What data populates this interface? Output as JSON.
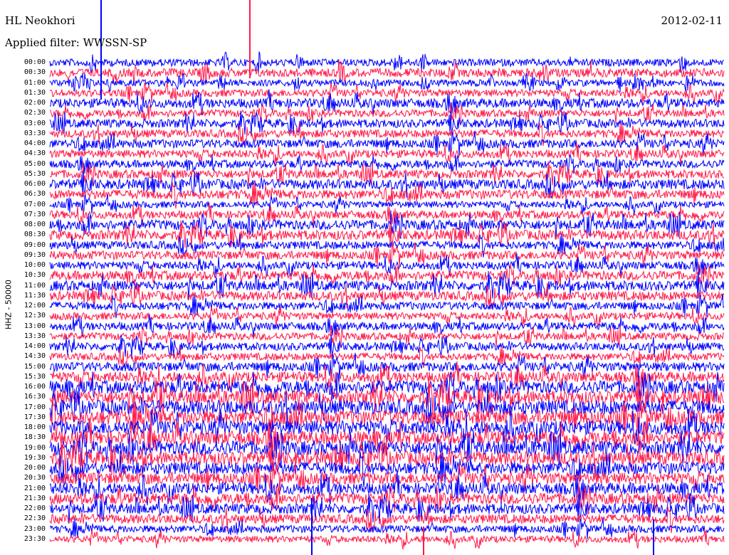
{
  "header": {
    "station": "HL Neokhori",
    "date": "2012-02-11",
    "filter": "Applied filter: WWSSN-SP"
  },
  "chart_data": {
    "type": "line",
    "title": "HL Neokhori",
    "ylabel": "HHZ - 50000",
    "xlabel": "",
    "trace_colors": [
      "#0000ff",
      "#ff1a4a"
    ],
    "rows": [
      "00:00",
      "00:30",
      "01:00",
      "01:30",
      "02:00",
      "02:30",
      "03:00",
      "03:30",
      "04:00",
      "04:30",
      "05:00",
      "05:30",
      "06:00",
      "06:30",
      "07:00",
      "07:30",
      "08:00",
      "08:30",
      "09:00",
      "09:30",
      "10:00",
      "10:30",
      "11:00",
      "11:30",
      "12:00",
      "12:30",
      "13:00",
      "13:30",
      "14:00",
      "14:30",
      "15:00",
      "15:30",
      "16:00",
      "16:30",
      "17:00",
      "17:30",
      "18:00",
      "18:30",
      "19:00",
      "19:30",
      "20:00",
      "20:30",
      "21:00",
      "21:30",
      "22:00",
      "22:30",
      "23:00",
      "23:30"
    ],
    "amplitude_level": [
      0.35,
      0.45,
      0.3,
      0.35,
      0.5,
      0.35,
      0.45,
      0.4,
      0.45,
      0.4,
      0.4,
      0.45,
      0.55,
      0.5,
      0.3,
      0.4,
      0.55,
      0.55,
      0.4,
      0.45,
      0.4,
      0.5,
      0.55,
      0.5,
      0.4,
      0.35,
      0.4,
      0.35,
      0.4,
      0.35,
      0.5,
      0.6,
      0.8,
      0.85,
      0.9,
      0.9,
      0.9,
      0.85,
      0.9,
      0.85,
      0.75,
      0.7,
      0.7,
      0.65,
      0.6,
      0.5,
      0.35,
      0.3
    ]
  }
}
